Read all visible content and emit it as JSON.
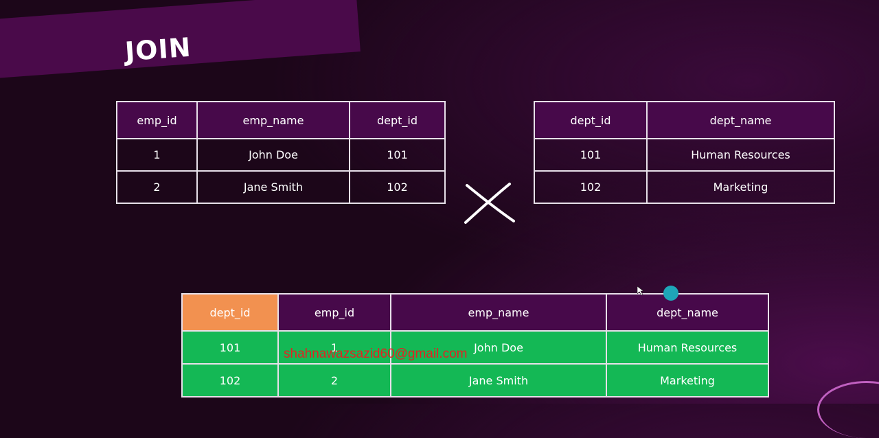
{
  "title": "JOIN",
  "employees": {
    "headers": [
      "emp_id",
      "emp_name",
      "dept_id"
    ],
    "rows": [
      [
        "1",
        "John Doe",
        "101"
      ],
      [
        "2",
        "Jane Smith",
        "102"
      ]
    ]
  },
  "departments": {
    "headers": [
      "dept_id",
      "dept_name"
    ],
    "rows": [
      [
        "101",
        "Human Resources"
      ],
      [
        "102",
        "Marketing"
      ]
    ]
  },
  "result": {
    "headers": [
      "dept_id",
      "emp_id",
      "emp_name",
      "dept_name"
    ],
    "rows": [
      [
        "101",
        "1",
        "John Doe",
        "Human Resources"
      ],
      [
        "102",
        "2",
        "Jane Smith",
        "Marketing"
      ]
    ]
  },
  "watermark": "shahnawazsazid60@gmail.com",
  "colors": {
    "header_bg": "#47094a",
    "key_header": "#f29150",
    "result_row": "#14b855",
    "watermark": "#e22222"
  },
  "icons": {
    "operator": "cross-icon"
  }
}
